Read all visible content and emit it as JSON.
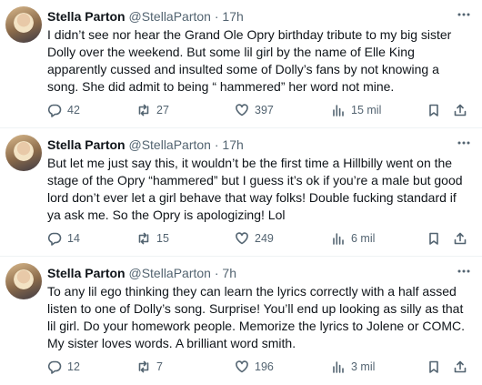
{
  "tweets": [
    {
      "name": "Stella Parton",
      "handle": "@StellaParton",
      "time": "· 17h",
      "text": "I didn’t see nor hear the Grand Ole Opry birthday tribute to my big sister\nDolly over the weekend. But some lil girl by the name of Elle King\napparently cussed and insulted some of Dolly’s fans by not knowing a\nsong. She did admit to being “ hammered” her word not mine.",
      "replies": "42",
      "retweets": "27",
      "likes": "397",
      "views": "15 mil"
    },
    {
      "name": "Stella Parton",
      "handle": "@StellaParton",
      "time": "· 17h",
      "text": "But let me just say this, it wouldn’t be the first time a Hillbilly went on the\nstage of the Opry “hammered” but I guess it’s ok if you’re a male but good\nlord don’t ever let a girl behave that way folks! Double fucking standard if\nya ask me. So the Opry is apologizing! Lol",
      "replies": "14",
      "retweets": "15",
      "likes": "249",
      "views": "6 mil"
    },
    {
      "name": "Stella Parton",
      "handle": "@StellaParton",
      "time": "· 7h",
      "text": "To any lil ego thinking they can learn the lyrics correctly with a half assed\nlisten to one of Dolly’s song. Surprise! You’ll end up looking as silly as that\nlil girl. Do your homework people. Memorize the lyrics to Jolene or COMC.\nMy sister loves words. A brilliant word smith.",
      "replies": "12",
      "retweets": "7",
      "likes": "196",
      "views": "3 mil"
    }
  ],
  "icons": {
    "more": "more-horizontal-icon",
    "reply": "reply-icon",
    "retweet": "retweet-icon",
    "like": "heart-icon",
    "views": "views-chart-icon",
    "bookmark": "bookmark-icon",
    "share": "share-icon"
  },
  "colors": {
    "text": "#0f1419",
    "secondary": "#536471",
    "divider": "#eff3f4",
    "background": "#ffffff"
  }
}
